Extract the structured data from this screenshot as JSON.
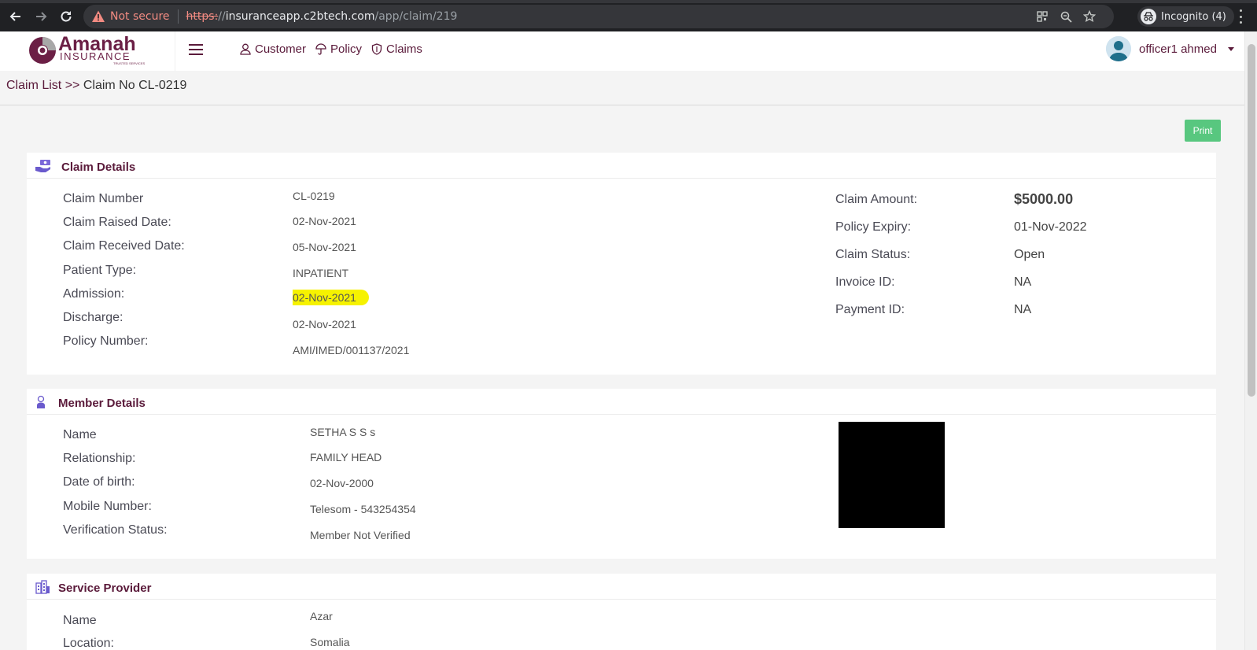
{
  "browser": {
    "not_secure_label": "Not secure",
    "url_scheme": "https:",
    "url_slashes": "//",
    "url_host": "insuranceapp.c2btech.com",
    "url_path": "/app/claim/219",
    "incognito_label": "Incognito (4)"
  },
  "header": {
    "logo_name": "Amanah",
    "logo_sub": "INSURANCE",
    "logo_tagline": "TRUSTED SERVICES",
    "nav": [
      {
        "label": "Customer",
        "icon": "person-icon"
      },
      {
        "label": "Policy",
        "icon": "umbrella-icon"
      },
      {
        "label": "Claims",
        "icon": "shield-icon"
      }
    ],
    "user_name": "officer1 ahmed"
  },
  "breadcrumb": {
    "parent": "Claim List",
    "separator": ">>",
    "current": "Claim No CL-0219"
  },
  "print_label": "Print",
  "claim_details": {
    "title": "Claim Details",
    "fields_left": [
      {
        "label": "Claim Number",
        "value": "CL-0219"
      },
      {
        "label": "Claim Raised Date:",
        "value": "02-Nov-2021"
      },
      {
        "label": "Claim Received Date:",
        "value": "05-Nov-2021"
      },
      {
        "label": "Patient Type:",
        "value": "INPATIENT"
      },
      {
        "label": "Admission:",
        "value": "02-Nov-2021"
      },
      {
        "label": "Discharge:",
        "value": "02-Nov-2021"
      },
      {
        "label": "Policy Number:",
        "value": "AMI/IMED/001137/2021"
      }
    ],
    "fields_right": [
      {
        "label": "Claim Amount:",
        "value": "$5000.00"
      },
      {
        "label": "Policy Expiry:",
        "value": "01-Nov-2022"
      },
      {
        "label": "Claim Status:",
        "value": "Open"
      },
      {
        "label": "Invoice ID:",
        "value": "NA"
      },
      {
        "label": "Payment ID:",
        "value": "NA"
      }
    ]
  },
  "member_details": {
    "title": "Member Details",
    "fields": [
      {
        "label": "Name",
        "value": "SETHA S S s"
      },
      {
        "label": "Relationship:",
        "value": "FAMILY HEAD"
      },
      {
        "label": "Date of birth:",
        "value": "02-Nov-2000"
      },
      {
        "label": "Mobile Number:",
        "value": "Telesom - 543254354"
      },
      {
        "label": "Verification Status:",
        "value": "Member Not Verified"
      }
    ]
  },
  "service_provider": {
    "title": "Service Provider",
    "fields": [
      {
        "label": "Name",
        "value": "Azar"
      },
      {
        "label": "Location:",
        "value": "Somalia"
      }
    ]
  },
  "colors": {
    "brand": "#5a1a3a",
    "print_button": "#58c77f",
    "highlight": "#f6f200"
  }
}
